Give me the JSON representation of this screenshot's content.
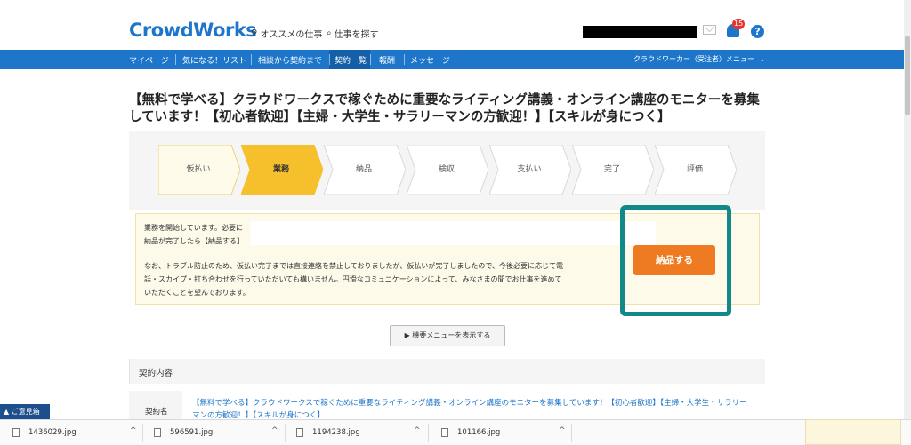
{
  "header": {
    "logo": "CrowdWorks",
    "nav_recommend": "オススメの仕事",
    "nav_search": "仕事を探す",
    "notification_count": "15",
    "help": "?"
  },
  "navbar": {
    "items": [
      "マイページ",
      "気になる！リスト",
      "相談から契約まで",
      "契約一覧",
      "報酬",
      "メッセージ"
    ],
    "right_menu": "クラウドワーカー（受注者）メニュー"
  },
  "job": {
    "title": "【無料で学べる】クラウドワークスで稼ぐために重要なライティング講義・オンライン講座のモニターを募集しています！【初心者歓迎】【主婦・大学生・サラリーマンの方歓迎！】【スキルが身につく】"
  },
  "progress": {
    "steps": [
      "仮払い",
      "業務",
      "納品",
      "検収",
      "支払い",
      "完了",
      "評価"
    ],
    "active_index": 1,
    "completed_index": 0
  },
  "notice": {
    "line1": "業務を開始しています。必要に",
    "line2": "納品が完了したら【納品する】",
    "line3": "なお、トラブル防止のため、仮払い完了までは直接連絡を禁止しておりましたが、仮払いが完了しましたので、今後必要に応じて電",
    "line4": "話・スカイプ・打ち合わせを行っていただいても構いません。円滑なコミュニケーションによって、みなさまの間でお仕事を進めて",
    "line5": "いただくことを望んでおります。",
    "deliver_button": "納品する"
  },
  "menu_button": "▶ 機要メニューを表示する",
  "contract": {
    "heading": "契約内容",
    "label": "契約名",
    "name_line1": "【無料で学べる】クラウドワークスで稼ぐために重要なライティング講義・オンライン講座のモニターを募集しています！【初心者歓迎】【主婦・大学生・サラリー",
    "name_line2": "マンの方歓迎！】【スキルが身につく】"
  },
  "feedback_tab": "▲ ご意見箱",
  "downloads": [
    "1436029.jpg",
    "596591.jpg",
    "1194238.jpg",
    "101166.jpg"
  ],
  "colors": {
    "brand_blue": "#1d76c9",
    "active_step": "#f6bf2c",
    "deliver_orange": "#ee7a22",
    "highlight_teal": "#138888"
  }
}
